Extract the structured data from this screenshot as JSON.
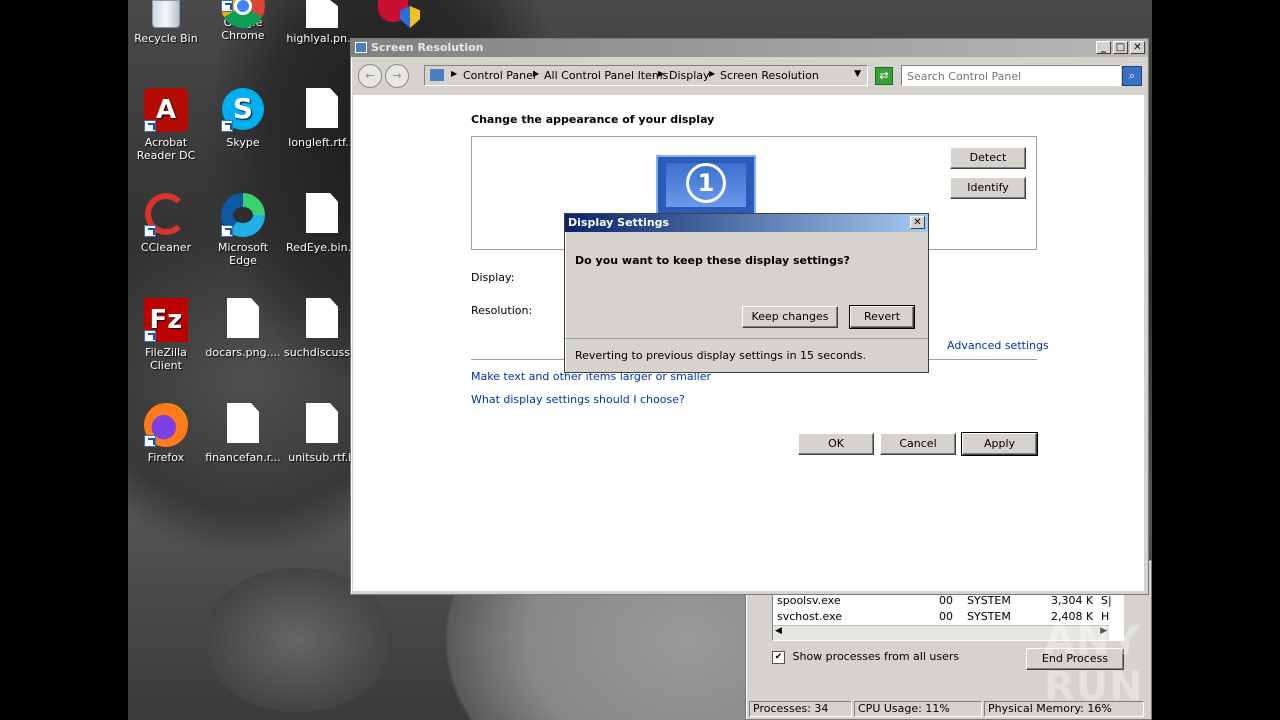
{
  "desktop": {
    "icons": [
      {
        "label": "Recycle Bin",
        "icon": "recycle-bin-icon"
      },
      {
        "label": "Google Chrome",
        "icon": "chrome-icon"
      },
      {
        "label": "highlyal.pn...",
        "icon": "file-icon"
      },
      {
        "label": "Acrobat Reader DC",
        "icon": "acrobat-icon"
      },
      {
        "label": "Skype",
        "icon": "skype-icon"
      },
      {
        "label": "longleft.rtf...",
        "icon": "file-icon"
      },
      {
        "label": "CCleaner",
        "icon": "ccleaner-icon"
      },
      {
        "label": "Microsoft Edge",
        "icon": "edge-icon"
      },
      {
        "label": "RedEye.bin...",
        "icon": "file-icon"
      },
      {
        "label": "FileZilla Client",
        "icon": "filezilla-icon"
      },
      {
        "label": "docars.png....",
        "icon": "file-icon"
      },
      {
        "label": "suchdiscuss...",
        "icon": "file-icon"
      },
      {
        "label": "Firefox",
        "icon": "firefox-icon"
      },
      {
        "label": "financefan.r...",
        "icon": "file-icon"
      },
      {
        "label": "unitsub.rtf.R",
        "icon": "file-icon"
      }
    ]
  },
  "task_manager": {
    "rows": [
      {
        "name": "spoolsv.exe",
        "session": "00",
        "user": "SYSTEM",
        "mem": "3,304 K",
        "desc": "S|"
      },
      {
        "name": "svchost.exe",
        "session": "00",
        "user": "SYSTEM",
        "mem": "2,408 K",
        "desc": "H"
      }
    ],
    "show_all_label": "Show processes from all users",
    "end_process_label": "End Process",
    "status": {
      "processes": "Processes: 34",
      "cpu": "CPU Usage: 11%",
      "memory": "Physical Memory: 16%"
    }
  },
  "screen_resolution": {
    "title": "Screen Resolution",
    "breadcrumb": [
      "Control Panel",
      "All Control Panel Items",
      "Display",
      "Screen Resolution"
    ],
    "search_placeholder": "Search Control Panel",
    "heading": "Change the appearance of your display",
    "monitor_number": "1",
    "detect_label": "Detect",
    "identify_label": "Identify",
    "display_label": "Display:",
    "resolution_label": "Resolution:",
    "advanced_settings": "Advanced settings",
    "link_text_size": "Make text and other items larger or smaller",
    "link_choose": "What display settings should I choose?",
    "ok_label": "OK",
    "cancel_label": "Cancel",
    "apply_label": "Apply"
  },
  "display_settings_dialog": {
    "title": "Display Settings",
    "question": "Do you want to keep these display settings?",
    "keep_label": "Keep changes",
    "revert_label": "Revert",
    "countdown": "Reverting to previous display settings in 15 seconds."
  },
  "watermark": {
    "text": "ANY RUN"
  }
}
